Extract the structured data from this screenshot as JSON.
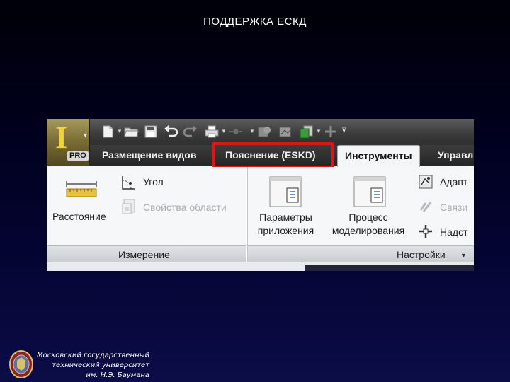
{
  "slide": {
    "title": "ПОДДЕРЖКА ЕСКД"
  },
  "ribbon": {
    "app_button": {
      "logo_letter": "I",
      "badge": "PRO"
    },
    "tabs": [
      {
        "label": "Размещение видов",
        "active": false
      },
      {
        "label": "Пояснение (ESKD)",
        "active": false,
        "highlighted": true
      },
      {
        "label": "Инструменты",
        "active": true
      },
      {
        "label": "Управл",
        "active": false
      }
    ],
    "measure_panel": {
      "distance_label": "Расстояние",
      "angle_label": "Угол",
      "region_props_label": "Свойства области",
      "footer_label": "Измерение"
    },
    "settings_panel": {
      "app_options_label_line1": "Параметры",
      "app_options_label_line2": "приложения",
      "process_label_line1": "Процесс",
      "process_label_line2": "моделирования",
      "adapt_label": "Адапт",
      "links_label": "Связи",
      "addins_label": "Надст",
      "footer_label": "Настройки"
    },
    "highlight_color": "#d81818"
  },
  "university": {
    "line1": "Московский государственный",
    "line2": "технический университет",
    "line3": "им. Н.Э. Баумана"
  }
}
